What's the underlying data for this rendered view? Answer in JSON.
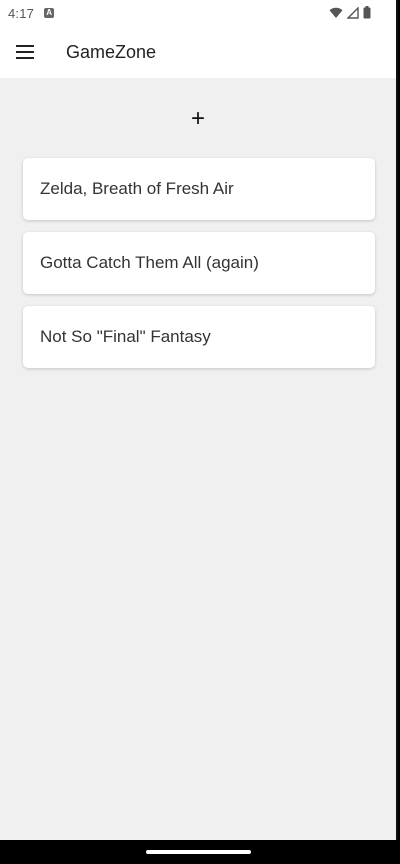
{
  "status_bar": {
    "time": "4:17",
    "notification_icon": "a-notification-icon"
  },
  "app_bar": {
    "title": "GameZone",
    "menu_icon": "hamburger-menu-icon"
  },
  "add_button": {
    "label": "+"
  },
  "games": [
    {
      "title": "Zelda, Breath of Fresh Air"
    },
    {
      "title": "Gotta Catch Them All (again)"
    },
    {
      "title": "Not So \"Final\" Fantasy"
    }
  ]
}
